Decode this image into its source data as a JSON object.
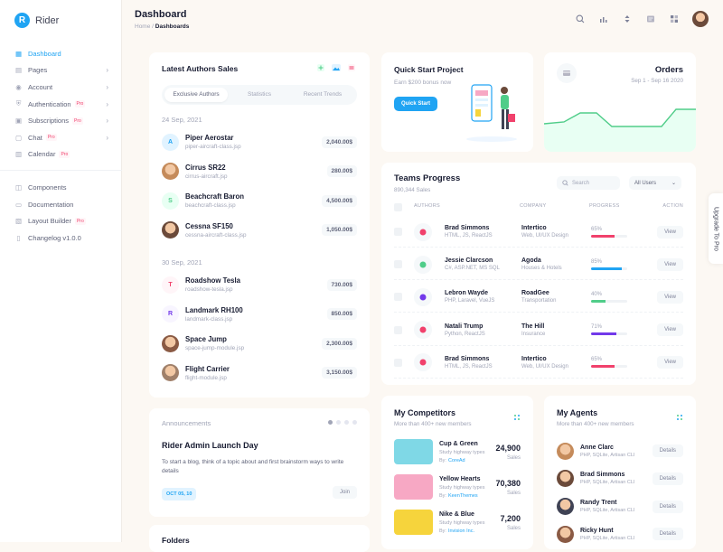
{
  "app": {
    "logo_letter": "R",
    "name": "Rider"
  },
  "sidebar": {
    "items": [
      {
        "label": "Dashboard",
        "icon": "grid-icon",
        "active": true
      },
      {
        "label": "Pages",
        "icon": "pages-icon",
        "chevron": true
      },
      {
        "label": "Account",
        "icon": "user-icon",
        "chevron": true
      },
      {
        "label": "Authentication",
        "icon": "shield-icon",
        "pro": "Pro",
        "chevron": true
      },
      {
        "label": "Subscriptions",
        "icon": "cart-icon",
        "pro": "Pro",
        "chevron": true
      },
      {
        "label": "Chat",
        "icon": "chat-icon",
        "pro": "Pro",
        "chevron": true
      },
      {
        "label": "Calendar",
        "icon": "calendar-icon",
        "pro": "Pro"
      }
    ],
    "items2": [
      {
        "label": "Components",
        "icon": "layers-icon"
      },
      {
        "label": "Documentation",
        "icon": "book-icon"
      },
      {
        "label": "Layout Builder",
        "icon": "layout-icon",
        "pro": "Pro"
      },
      {
        "label": "Changelog v1.0.0",
        "icon": "file-icon"
      }
    ]
  },
  "header": {
    "title": "Dashboard",
    "crumb_home": "Home",
    "crumb_sep": "/",
    "crumb_current": "Dashboards"
  },
  "authors": {
    "title": "Latest Authors Sales",
    "tabs": [
      "Exclusive Authors",
      "Statistics",
      "Recent Trends"
    ],
    "groups": [
      {
        "date": "24 Sep, 2021",
        "rows": [
          {
            "initial": "A",
            "name": "Piper Aerostar",
            "file": "piper-aircraft-class.jsp",
            "amount": "2,040.00$"
          },
          {
            "initial": "",
            "name": "Cirrus SR22",
            "file": "cirrus-aircraft.jsp",
            "amount": "280.00$"
          },
          {
            "initial": "S",
            "name": "Beachcraft Baron",
            "file": "beachcraft-class.jsp",
            "amount": "4,500.00$"
          },
          {
            "initial": "",
            "name": "Cessna SF150",
            "file": "cessna-aircraft-class.jsp",
            "amount": "1,050.00$"
          }
        ]
      },
      {
        "date": "30 Sep, 2021",
        "rows": [
          {
            "initial": "T",
            "name": "Roadshow Tesla",
            "file": "roadshow-tesla.jsp",
            "amount": "730.00$"
          },
          {
            "initial": "R",
            "name": "Landmark RH100",
            "file": "landmark-class.jsp",
            "amount": "850.00$"
          },
          {
            "initial": "",
            "name": "Space Jump",
            "file": "space-jump-module.jsp",
            "amount": "2,300.00$"
          },
          {
            "initial": "",
            "name": "Flight Carrier",
            "file": "flight-module.jsp",
            "amount": "3,150.00$"
          }
        ]
      }
    ]
  },
  "announcements": {
    "label": "Announcements",
    "title": "Rider Admin Launch Day",
    "body": "To start a blog, think of a topic about and first brainstorm ways to write details",
    "date": "OCT 05, 10",
    "button": "Join"
  },
  "folders": {
    "title": "Folders"
  },
  "quick_start": {
    "title": "Quick Start Project",
    "sub": "Earn $200 bonus now",
    "button": "Quick Start"
  },
  "orders": {
    "title": "Orders",
    "range": "Sep 1 - Sep 16 2020"
  },
  "teams": {
    "title": "Teams Progress",
    "sub": "890,344 Sales",
    "search_placeholder": "Search",
    "filter": "All Users",
    "cols": [
      "AUTHORS",
      "COMPANY",
      "PROGRESS",
      "ACTION"
    ],
    "rows": [
      {
        "name": "Brad Simmons",
        "skills": "HTML, JS, ReactJS",
        "company": "Intertico",
        "role": "Web, UI/UX Design",
        "progress": "65%",
        "pct": 65,
        "color": "#f1416c",
        "btn": "View"
      },
      {
        "name": "Jessie Clarcson",
        "skills": "C#, ASP.NET, MS SQL",
        "company": "Agoda",
        "role": "Houses & Hotels",
        "progress": "85%",
        "pct": 85,
        "color": "#20a4f3",
        "btn": "View"
      },
      {
        "name": "Lebron Wayde",
        "skills": "PHP, Laravel, VueJS",
        "company": "RoadGee",
        "role": "Transportation",
        "progress": "40%",
        "pct": 40,
        "color": "#50cd89",
        "btn": "View"
      },
      {
        "name": "Natali Trump",
        "skills": "Python, ReactJS",
        "company": "The Hill",
        "role": "Insurance",
        "progress": "71%",
        "pct": 71,
        "color": "#7239ea",
        "btn": "View"
      },
      {
        "name": "Brad Simmons",
        "skills": "HTML, JS, ReactJS",
        "company": "Intertico",
        "role": "Web, UI/UX Design",
        "progress": "65%",
        "pct": 65,
        "color": "#f1416c",
        "btn": "View"
      }
    ]
  },
  "competitors": {
    "title": "My Competitors",
    "sub": "More than 400+ new members",
    "rows": [
      {
        "name": "Cup & Green",
        "desc": "Study highway types",
        "by": "By:",
        "author": "CoreAd",
        "value": "24,900",
        "unit": "Sales",
        "color": "#7fd8e6"
      },
      {
        "name": "Yellow Hearts",
        "desc": "Study highway types",
        "by": "By:",
        "author": "KeenThemes",
        "value": "70,380",
        "unit": "Sales",
        "color": "#f7a8c4"
      },
      {
        "name": "Nike & Blue",
        "desc": "Study highway types",
        "by": "By:",
        "author": "Invision Inc.",
        "value": "7,200",
        "unit": "Sales",
        "color": "#f6d43c"
      }
    ]
  },
  "agents": {
    "title": "My Agents",
    "sub": "More than 400+ new members",
    "rows": [
      {
        "name": "Anne Clarc",
        "skills": "PHP, SQLite, Artisan CLI",
        "btn": "Details"
      },
      {
        "name": "Brad Simmons",
        "skills": "PHP, SQLite, Artisan CLI",
        "btn": "Details"
      },
      {
        "name": "Randy Trent",
        "skills": "PHP, SQLite, Artisan CLI",
        "btn": "Details"
      },
      {
        "name": "Ricky Hunt",
        "skills": "PHP, SQLite, Artisan CLI",
        "btn": "Details"
      }
    ]
  },
  "upgrade": {
    "label": "Upgrade To Pro"
  }
}
